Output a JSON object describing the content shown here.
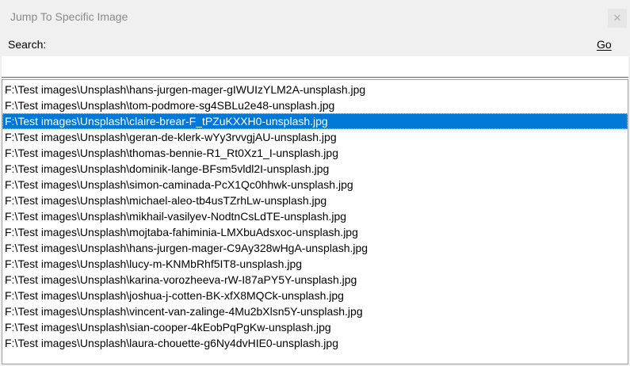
{
  "window": {
    "title": "Jump To Specific Image",
    "close_glyph": "✕"
  },
  "search": {
    "label": "Search:",
    "value": "",
    "placeholder": "",
    "go_label": "Go"
  },
  "list": {
    "selected_index": 2,
    "items": [
      "F:\\Test images\\Unsplash\\hans-jurgen-mager-gIWUIzYLM2A-unsplash.jpg",
      "F:\\Test images\\Unsplash\\tom-podmore-sg4SBLu2e48-unsplash.jpg",
      "F:\\Test images\\Unsplash\\claire-brear-F_tPZuKXXH0-unsplash.jpg",
      "F:\\Test images\\Unsplash\\geran-de-klerk-wYy3rvvgjAU-unsplash.jpg",
      "F:\\Test images\\Unsplash\\thomas-bennie-R1_Rt0Xz1_I-unsplash.jpg",
      "F:\\Test images\\Unsplash\\dominik-lange-BFsm5vldl2I-unsplash.jpg",
      "F:\\Test images\\Unsplash\\simon-caminada-PcX1Qc0hhwk-unsplash.jpg",
      "F:\\Test images\\Unsplash\\michael-aleo-tb4usTZrhLw-unsplash.jpg",
      "F:\\Test images\\Unsplash\\mikhail-vasilyev-NodtnCsLdTE-unsplash.jpg",
      "F:\\Test images\\Unsplash\\mojtaba-fahiminia-LMXbuAdsxoc-unsplash.jpg",
      "F:\\Test images\\Unsplash\\hans-jurgen-mager-C9Ay328wHgA-unsplash.jpg",
      "F:\\Test images\\Unsplash\\lucy-m-KNMbRhf5IT8-unsplash.jpg",
      "F:\\Test images\\Unsplash\\karina-vorozheeva-rW-I87aPY5Y-unsplash.jpg",
      "F:\\Test images\\Unsplash\\joshua-j-cotten-BK-xfX8MQCk-unsplash.jpg",
      "F:\\Test images\\Unsplash\\vincent-van-zalinge-4Mu2bXlsn5Y-unsplash.jpg",
      "F:\\Test images\\Unsplash\\sian-cooper-4kEobPqPgKw-unsplash.jpg",
      "F:\\Test images\\Unsplash\\laura-chouette-g6Ny4dvHIE0-unsplash.jpg"
    ]
  },
  "colors": {
    "selection": "#0078d7",
    "window_bg": "#f0f0f0"
  }
}
